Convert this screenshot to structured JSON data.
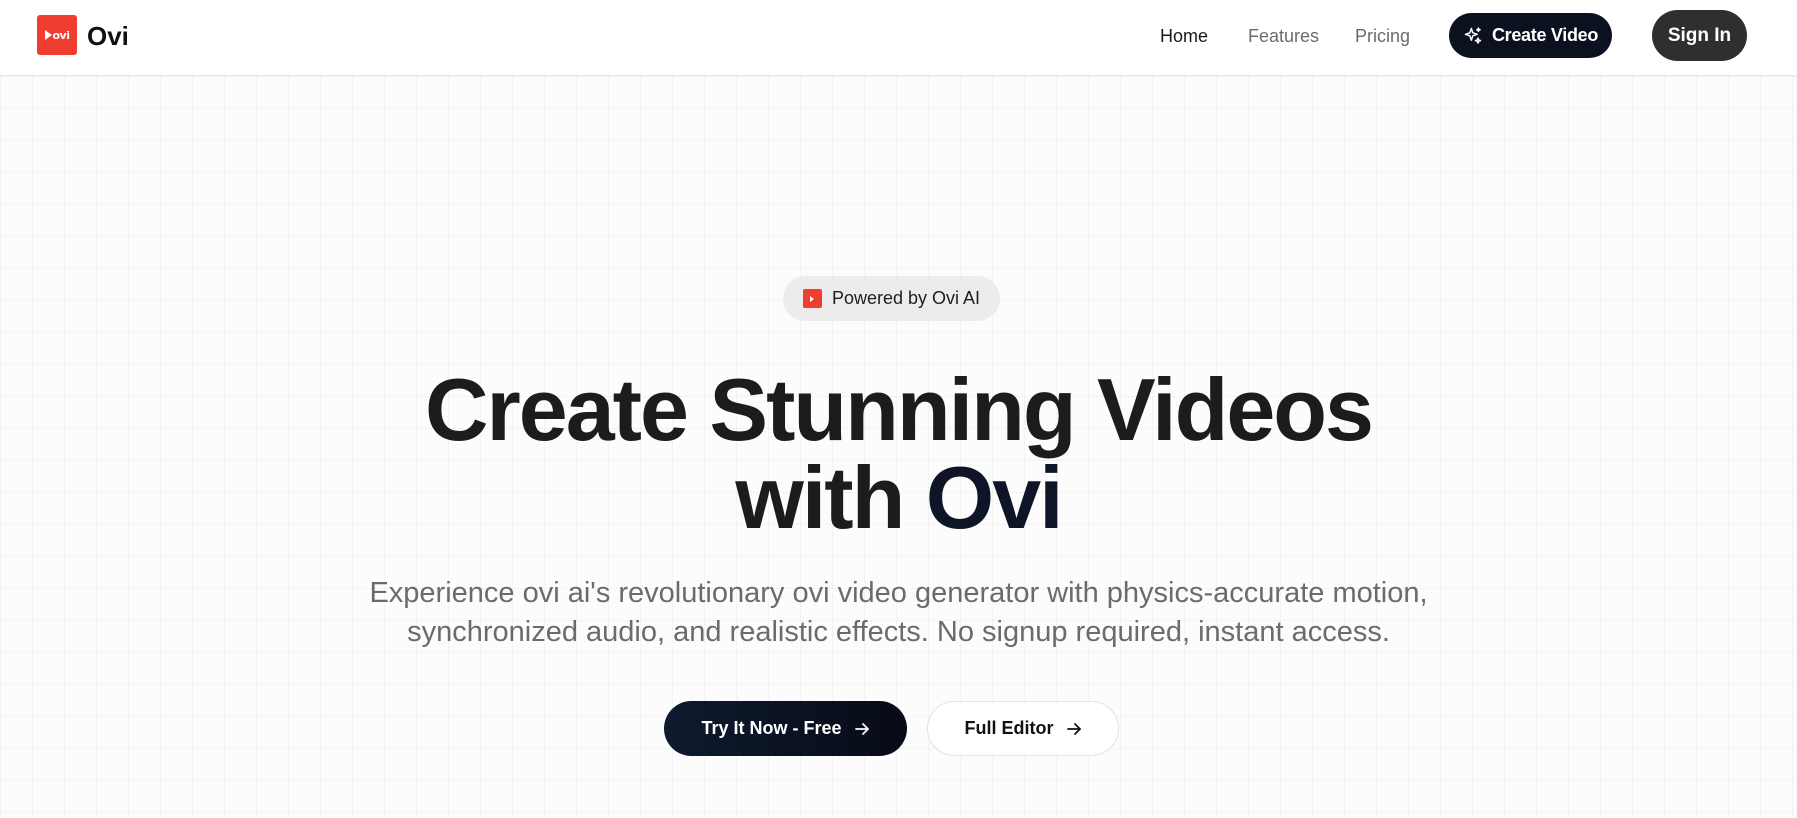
{
  "navbar": {
    "brand": "Ovi",
    "logo_text": "ovi",
    "links": [
      {
        "label": "Home",
        "active": true
      },
      {
        "label": "Features",
        "active": false
      },
      {
        "label": "Pricing",
        "active": false
      }
    ],
    "create_button": {
      "label": "Create Video",
      "icon": "sparkles-icon"
    },
    "signin_button": {
      "label": "Sign In"
    }
  },
  "hero": {
    "badge": {
      "label": "Powered by Ovi AI",
      "icon": "ovi-logo-icon"
    },
    "title_line1": "Create Stunning Videos",
    "title_line2_prefix": "with ",
    "title_line2_accent": "Ovi",
    "subtitle_line1": "Experience ovi ai's revolutionary ovi video generator with physics-accurate motion,",
    "subtitle_line2": "synchronized audio, and realistic effects. No signup required, instant access.",
    "primary_cta": {
      "label": "Try It Now - Free",
      "icon": "arrow-right-icon"
    },
    "secondary_cta": {
      "label": "Full Editor",
      "icon": "arrow-right-icon"
    }
  },
  "colors": {
    "brand_red": "#ef3e2f",
    "dark_navy": "#0c1120",
    "signin_gray": "#2f2f2f",
    "text_muted": "#6b6b6b"
  }
}
